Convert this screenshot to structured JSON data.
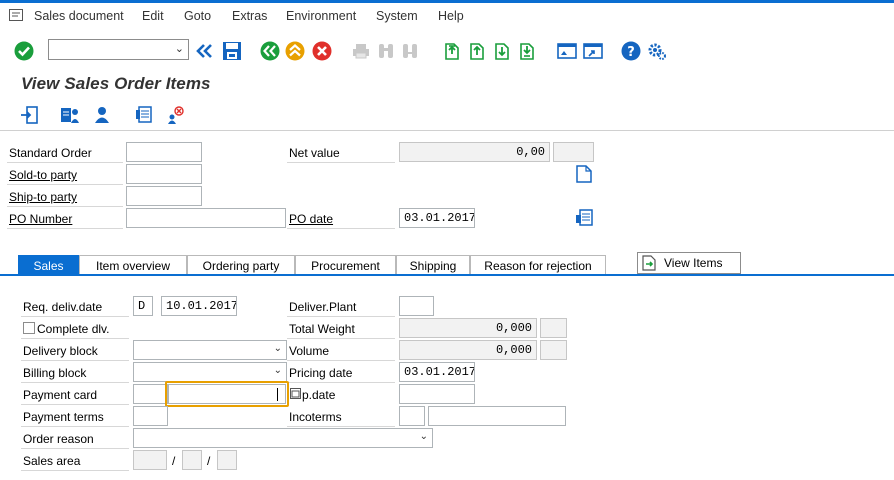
{
  "menu": {
    "sales_document": "Sales document",
    "edit": "Edit",
    "goto": "Goto",
    "extras": "Extras",
    "environment": "Environment",
    "system": "System",
    "help": "Help"
  },
  "toolbar": {
    "command_field_value": ""
  },
  "page_title": "View Sales Order Items",
  "header": {
    "standard_order_label": "Standard Order",
    "standard_order_value": "",
    "net_value_label": "Net value",
    "net_value_value": "0,00",
    "net_value_currency": "",
    "sold_to_label": "Sold-to party",
    "sold_to_value": "",
    "ship_to_label": "Ship-to party",
    "ship_to_value": "",
    "po_number_label": "PO Number",
    "po_number_value": "",
    "po_date_label": "PO date",
    "po_date_value": "03.01.2017"
  },
  "tabs": [
    {
      "label": "Sales"
    },
    {
      "label": "Item overview"
    },
    {
      "label": "Ordering party"
    },
    {
      "label": "Procurement"
    },
    {
      "label": "Shipping"
    },
    {
      "label": "Reason for rejection"
    }
  ],
  "view_items_label": "View Items",
  "sales_tab": {
    "req_deliv_label": "Req. deliv.date",
    "req_deliv_format": "D",
    "req_deliv_value": "10.01.2017",
    "deliver_plant_label": "Deliver.Plant",
    "deliver_plant_value": "",
    "complete_dlv_label": "Complete dlv.",
    "total_weight_label": "Total Weight",
    "total_weight_value": "0,000",
    "total_weight_unit": "",
    "delivery_block_label": "Delivery block",
    "delivery_block_value": "",
    "volume_label": "Volume",
    "volume_value": "0,000",
    "volume_unit": "",
    "billing_block_label": "Billing block",
    "billing_block_value": "",
    "pricing_date_label": "Pricing date",
    "pricing_date_value": "03.01.2017",
    "payment_card_label": "Payment card",
    "payment_card_type": "",
    "payment_card_value": "",
    "exp_date_label": "p.date",
    "exp_date_value": "",
    "payment_terms_label": "Payment terms",
    "payment_terms_value": "",
    "incoterms_label": "Incoterms",
    "incoterms_value": "",
    "incoterms_location": "",
    "order_reason_label": "Order reason",
    "order_reason_value": "",
    "sales_area_label": "Sales area",
    "sales_area_sep1": "/",
    "sales_area_sep2": "/"
  },
  "colors": {
    "accent": "#0a6ed1",
    "focus": "#e8a000",
    "green": "#1a9e3c",
    "orange": "#e8a000",
    "red": "#e0302b"
  }
}
